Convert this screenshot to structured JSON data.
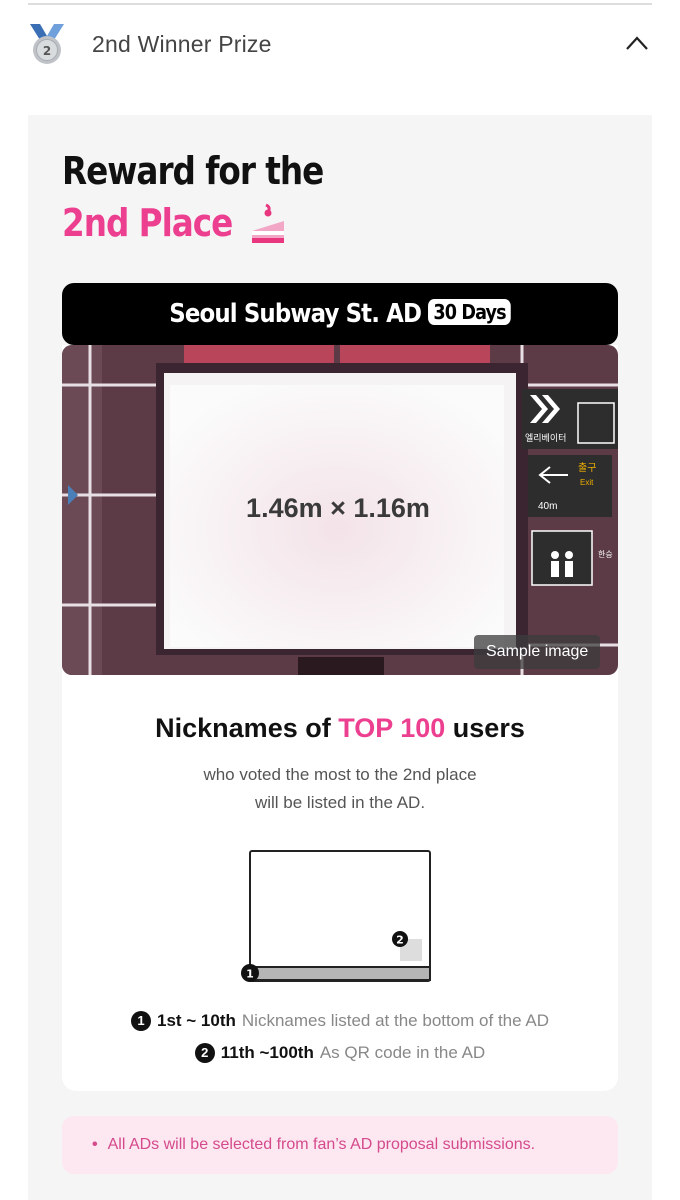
{
  "accordion": {
    "title": "2nd Winner Prize",
    "medal_icon": "silver-medal-icon",
    "medal_number": "2",
    "toggle_icon": "chevron-up-icon",
    "expanded": true
  },
  "reward": {
    "title_line1": "Reward for the",
    "title_line2": "2nd Place",
    "emoji_icon": "cake-icon",
    "accent_color": "#ec3f8f"
  },
  "banner": {
    "text": "Seoul Subway St. AD",
    "days_badge": "30 Days"
  },
  "photo": {
    "dimensions": "1.46m × 1.16m",
    "sample_label": "Sample image",
    "sign_texts": [
      "엘리베이터",
      "출구",
      "Exit",
      "40m",
      "한승"
    ]
  },
  "nicknames": {
    "title_prefix": "Nicknames of ",
    "title_highlight": "TOP 100",
    "title_suffix": " users",
    "subtitle_line1": "who voted the most to the 2nd place",
    "subtitle_line2": "will be listed in the AD."
  },
  "diagram": {
    "marker_1": "1",
    "marker_2": "2"
  },
  "legend": [
    {
      "marker": "1",
      "rank": "1st ~ 10th",
      "desc": "Nicknames listed at the bottom of the AD"
    },
    {
      "marker": "2",
      "rank": "11th ~100th",
      "desc": "As QR code in the AD"
    }
  ],
  "note": {
    "bullet": "•",
    "text": "All ADs will be selected from fan’s AD proposal submissions."
  },
  "colors": {
    "pink": "#ec3f8f",
    "note_bg": "#fde7f0",
    "panel_bg": "#f5f5f5"
  }
}
